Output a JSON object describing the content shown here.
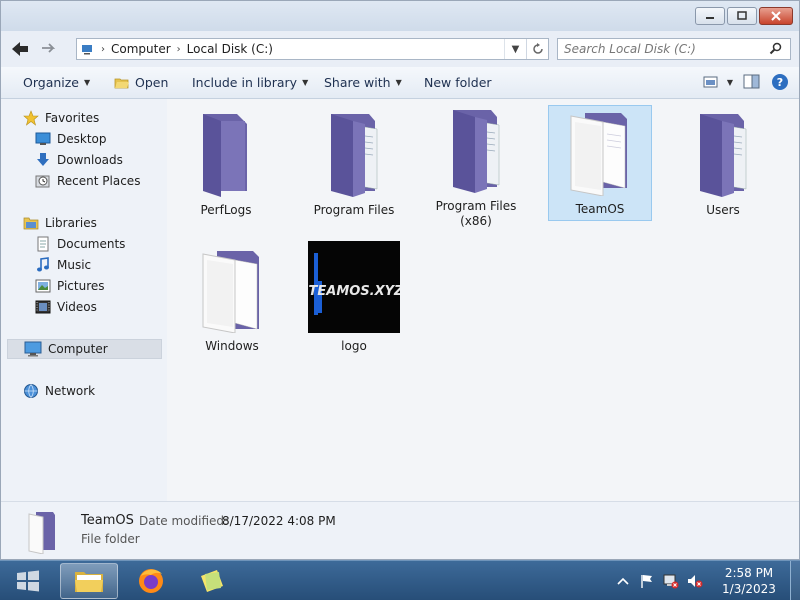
{
  "breadcrumbs": [
    "Computer",
    "Local Disk (C:)"
  ],
  "search": {
    "placeholder": "Search Local Disk (C:)"
  },
  "toolbar": {
    "organize": "Organize",
    "open": "Open",
    "include": "Include in library",
    "share": "Share with",
    "new_folder": "New folder"
  },
  "nav": {
    "favorites": "Favorites",
    "desktop": "Desktop",
    "downloads": "Downloads",
    "recent": "Recent Places",
    "libraries": "Libraries",
    "documents": "Documents",
    "music": "Music",
    "pictures": "Pictures",
    "videos": "Videos",
    "computer": "Computer",
    "network": "Network"
  },
  "items": [
    {
      "name": "PerfLogs",
      "type": "folder"
    },
    {
      "name": "Program Files",
      "type": "folder-docs"
    },
    {
      "name": "Program Files\n(x86)",
      "type": "folder-docs"
    },
    {
      "name": "TeamOS",
      "type": "folder-open",
      "selected": true
    },
    {
      "name": "Users",
      "type": "folder-docs"
    },
    {
      "name": "Windows",
      "type": "folder-open"
    },
    {
      "name": "logo",
      "type": "image",
      "logo_text": "TEAMOS.XYZ"
    }
  ],
  "details": {
    "name": "TeamOS",
    "modified_label": "Date modified:",
    "modified_value": "8/17/2022 4:08 PM",
    "type": "File folder"
  },
  "clock": {
    "time": "2:58 PM",
    "date": "1/3/2023"
  },
  "colors": {
    "folder": "#6a63a8",
    "selection": "#cce4f7",
    "taskbar": "#2f5a87"
  }
}
